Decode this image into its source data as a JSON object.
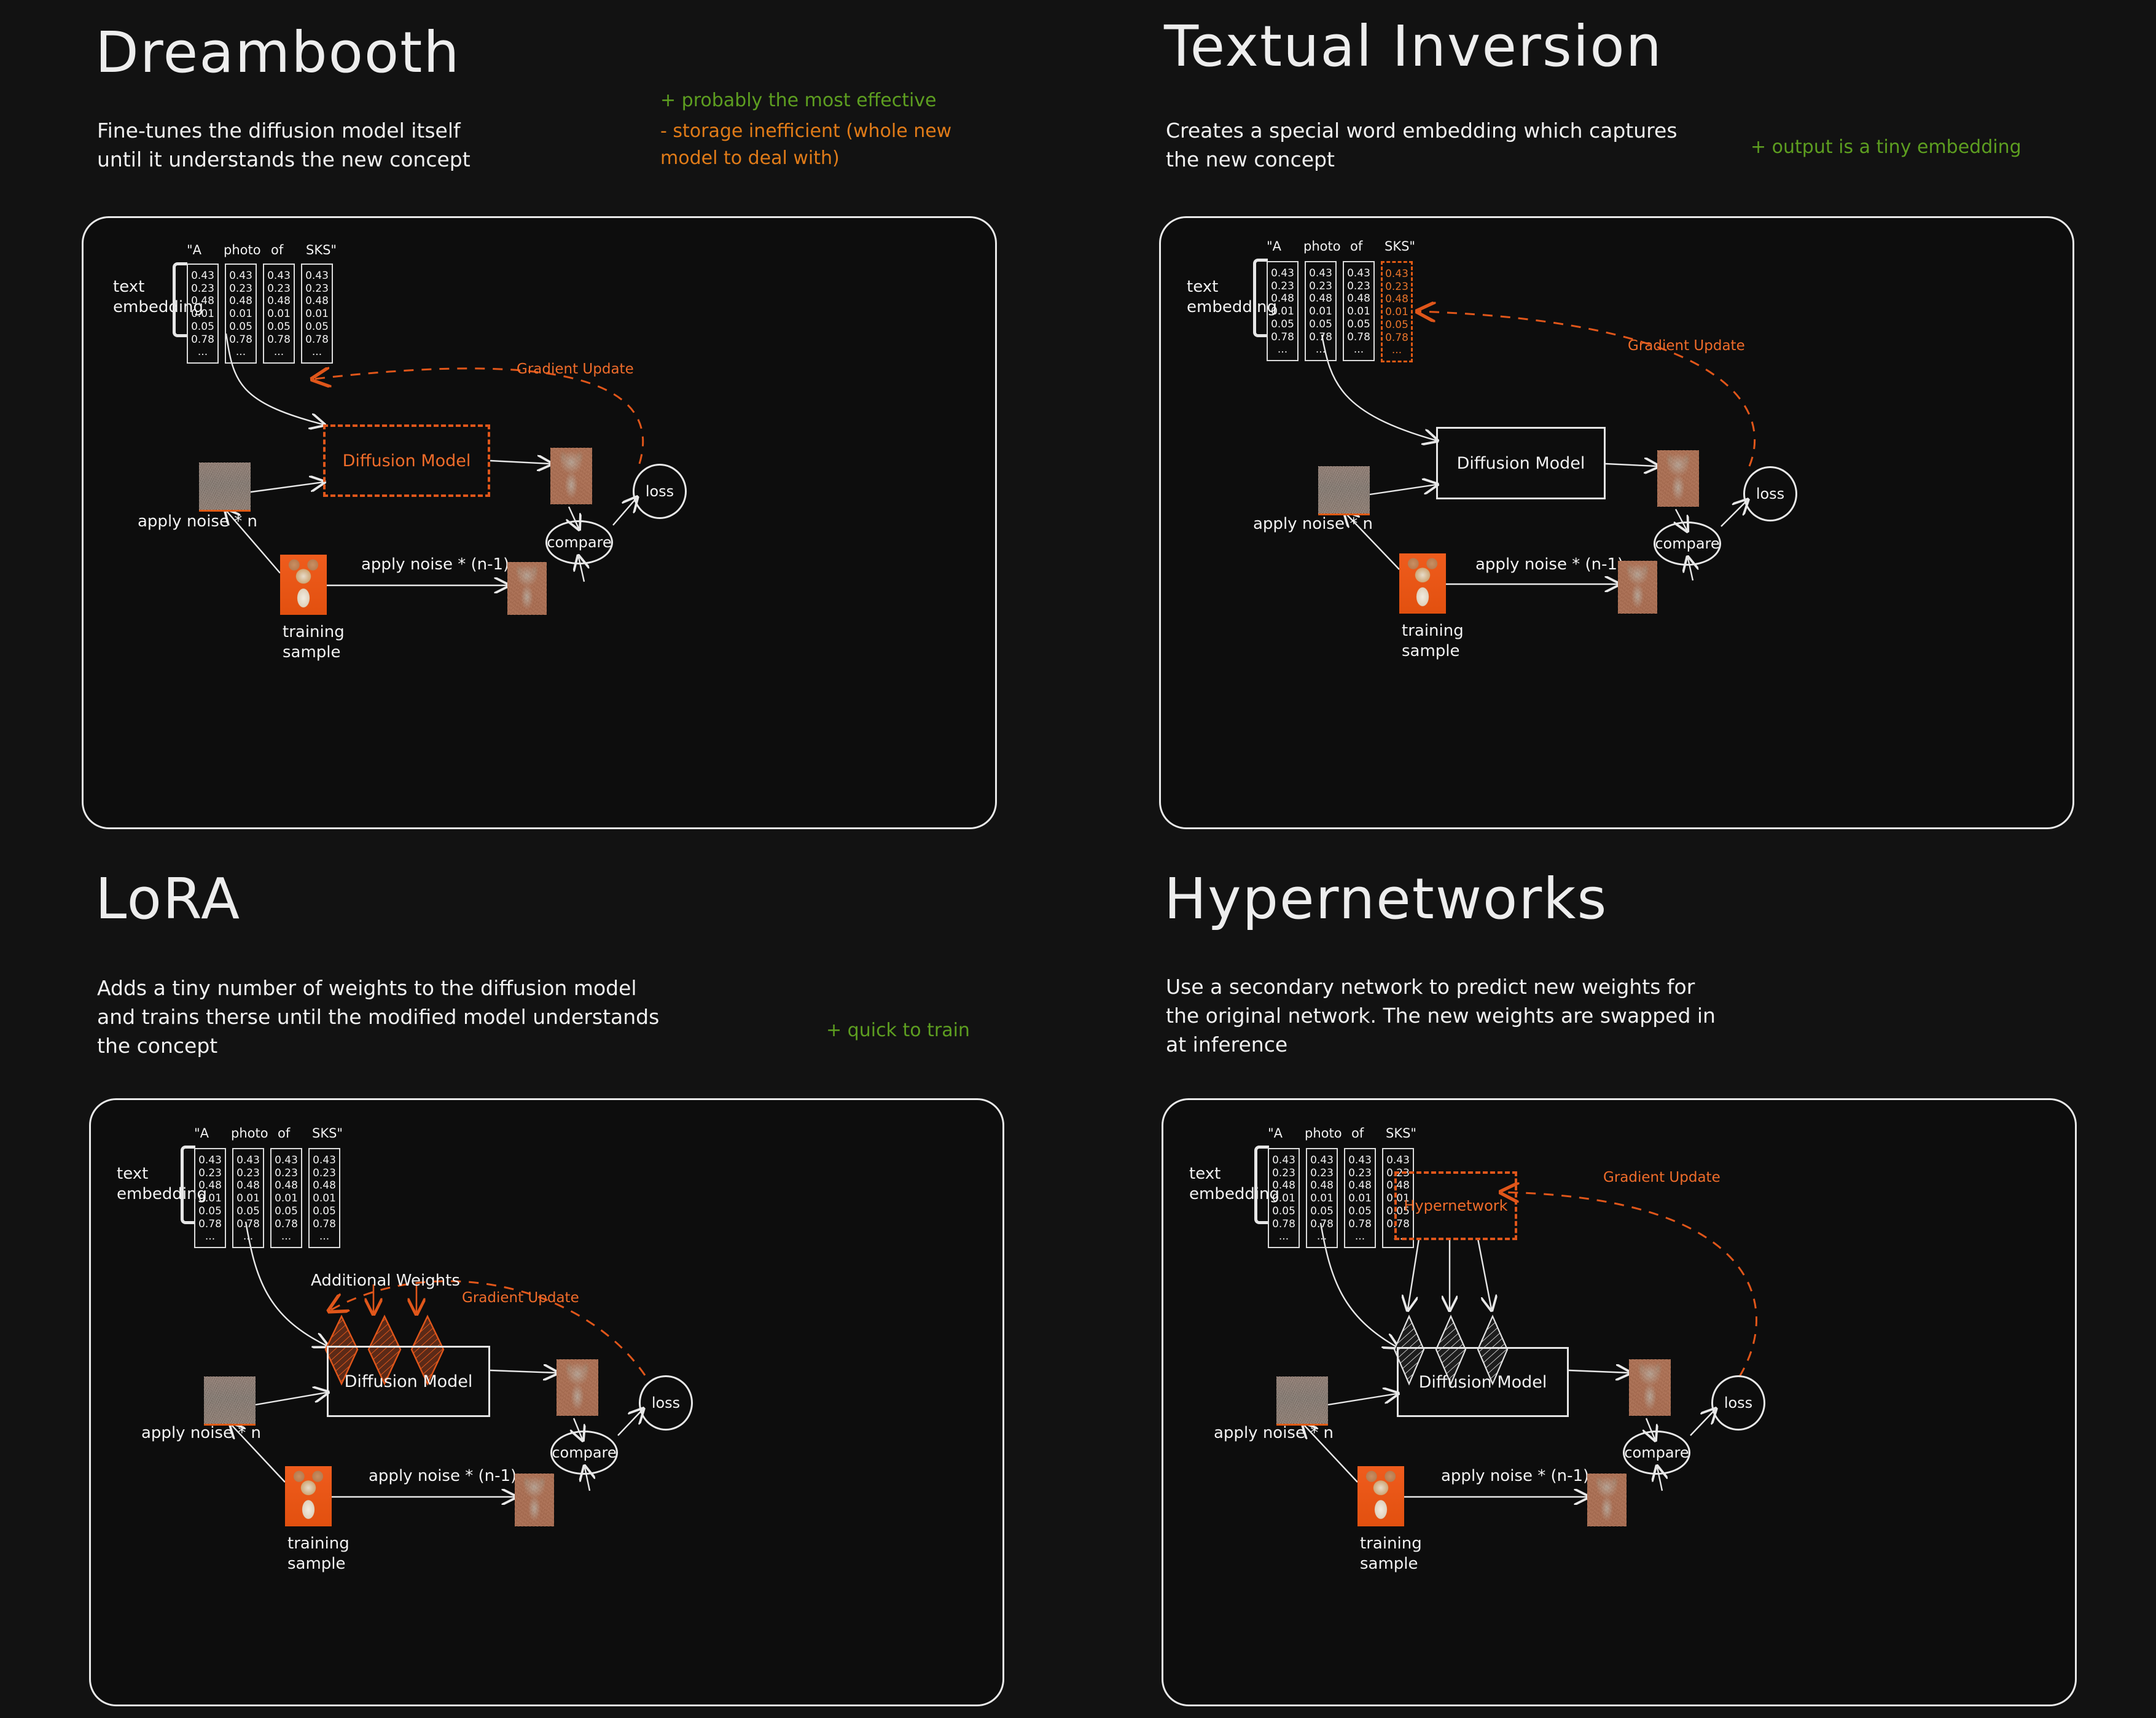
{
  "background_color": "#121212",
  "accent_orange": "#e0561a",
  "accent_green": "#5d9e20",
  "ink_white": "#ededed",
  "panels": [
    {
      "id": "dreambooth",
      "title": "Dreambooth",
      "subtitle": "Fine-tunes the diffusion model itself\nuntil it understands the new concept",
      "notes": [
        {
          "tone": "pos",
          "text": "+ probably the most effective"
        },
        {
          "tone": "neg",
          "text": "- storage inefficient (whole new\nmodel to deal with)"
        }
      ],
      "diagram": {
        "text_embedding_label": "text\nembedding",
        "prompt_tokens": [
          "\"A",
          "photo",
          "of",
          "SKS\""
        ],
        "vector_values": [
          "0.43",
          "0.23",
          "0.48",
          "0.01",
          "0.05",
          "0.78",
          "..."
        ],
        "highlighted_token_index": null,
        "model_box_label": "Diffusion Model",
        "model_box_style": "dashed-orange",
        "gradient_update_label": "Gradient Update",
        "compare_label": "compare",
        "loss_label": "loss",
        "apply_noise_n_label": "apply noise * n",
        "apply_noise_n1_label": "apply noise * (n-1)",
        "training_sample_label": "training\nsample",
        "extra_label": null,
        "hypernetwork_label": null
      }
    },
    {
      "id": "textual-inversion",
      "title": "Textual Inversion",
      "subtitle": "Creates a special word embedding which captures\nthe new concept",
      "notes": [
        {
          "tone": "pos",
          "text": "+ output is a tiny embedding"
        }
      ],
      "diagram": {
        "text_embedding_label": "text\nembedding",
        "prompt_tokens": [
          "\"A",
          "photo",
          "of",
          "SKS\""
        ],
        "vector_values": [
          "0.43",
          "0.23",
          "0.48",
          "0.01",
          "0.05",
          "0.78",
          "..."
        ],
        "highlighted_token_index": 3,
        "model_box_label": "Diffusion Model",
        "model_box_style": "solid-white",
        "gradient_update_label": "Gradient Update",
        "compare_label": "compare",
        "loss_label": "loss",
        "apply_noise_n_label": "apply noise * n",
        "apply_noise_n1_label": "apply noise * (n-1)",
        "training_sample_label": "training\nsample",
        "extra_label": null,
        "hypernetwork_label": null
      }
    },
    {
      "id": "lora",
      "title": "LoRA",
      "subtitle": "Adds a tiny number of weights to the diffusion model\nand trains therse until the modified model understands\nthe concept",
      "notes": [
        {
          "tone": "pos",
          "text": "+ quick to train"
        }
      ],
      "diagram": {
        "text_embedding_label": "text\nembedding",
        "prompt_tokens": [
          "\"A",
          "photo",
          "of",
          "SKS\""
        ],
        "vector_values": [
          "0.43",
          "0.23",
          "0.48",
          "0.01",
          "0.05",
          "0.78",
          "..."
        ],
        "highlighted_token_index": null,
        "model_box_label": "Diffusion Model",
        "model_box_style": "solid-white",
        "gradient_update_label": "Gradient Update",
        "compare_label": "compare",
        "loss_label": "loss",
        "apply_noise_n_label": "apply noise * n",
        "apply_noise_n1_label": "apply noise * (n-1)",
        "training_sample_label": "training\nsample",
        "extra_label": "Additional Weights",
        "hypernetwork_label": null
      }
    },
    {
      "id": "hypernetworks",
      "title": "Hypernetworks",
      "subtitle": "Use a secondary network to predict new weights for\nthe original network. The new weights are swapped in\nat inference",
      "notes": [],
      "diagram": {
        "text_embedding_label": "text\nembedding",
        "prompt_tokens": [
          "\"A",
          "photo",
          "of",
          "SKS\""
        ],
        "vector_values": [
          "0.43",
          "0.23",
          "0.48",
          "0.01",
          "0.05",
          "0.78",
          "..."
        ],
        "highlighted_token_index": null,
        "model_box_label": "Diffusion Model",
        "model_box_style": "solid-white",
        "gradient_update_label": "Gradient Update",
        "compare_label": "compare",
        "loss_label": "loss",
        "apply_noise_n_label": "apply noise * n",
        "apply_noise_n1_label": "apply noise * (n-1)",
        "training_sample_label": "training\nsample",
        "extra_label": null,
        "hypernetwork_label": "Hypernetwork"
      }
    }
  ]
}
